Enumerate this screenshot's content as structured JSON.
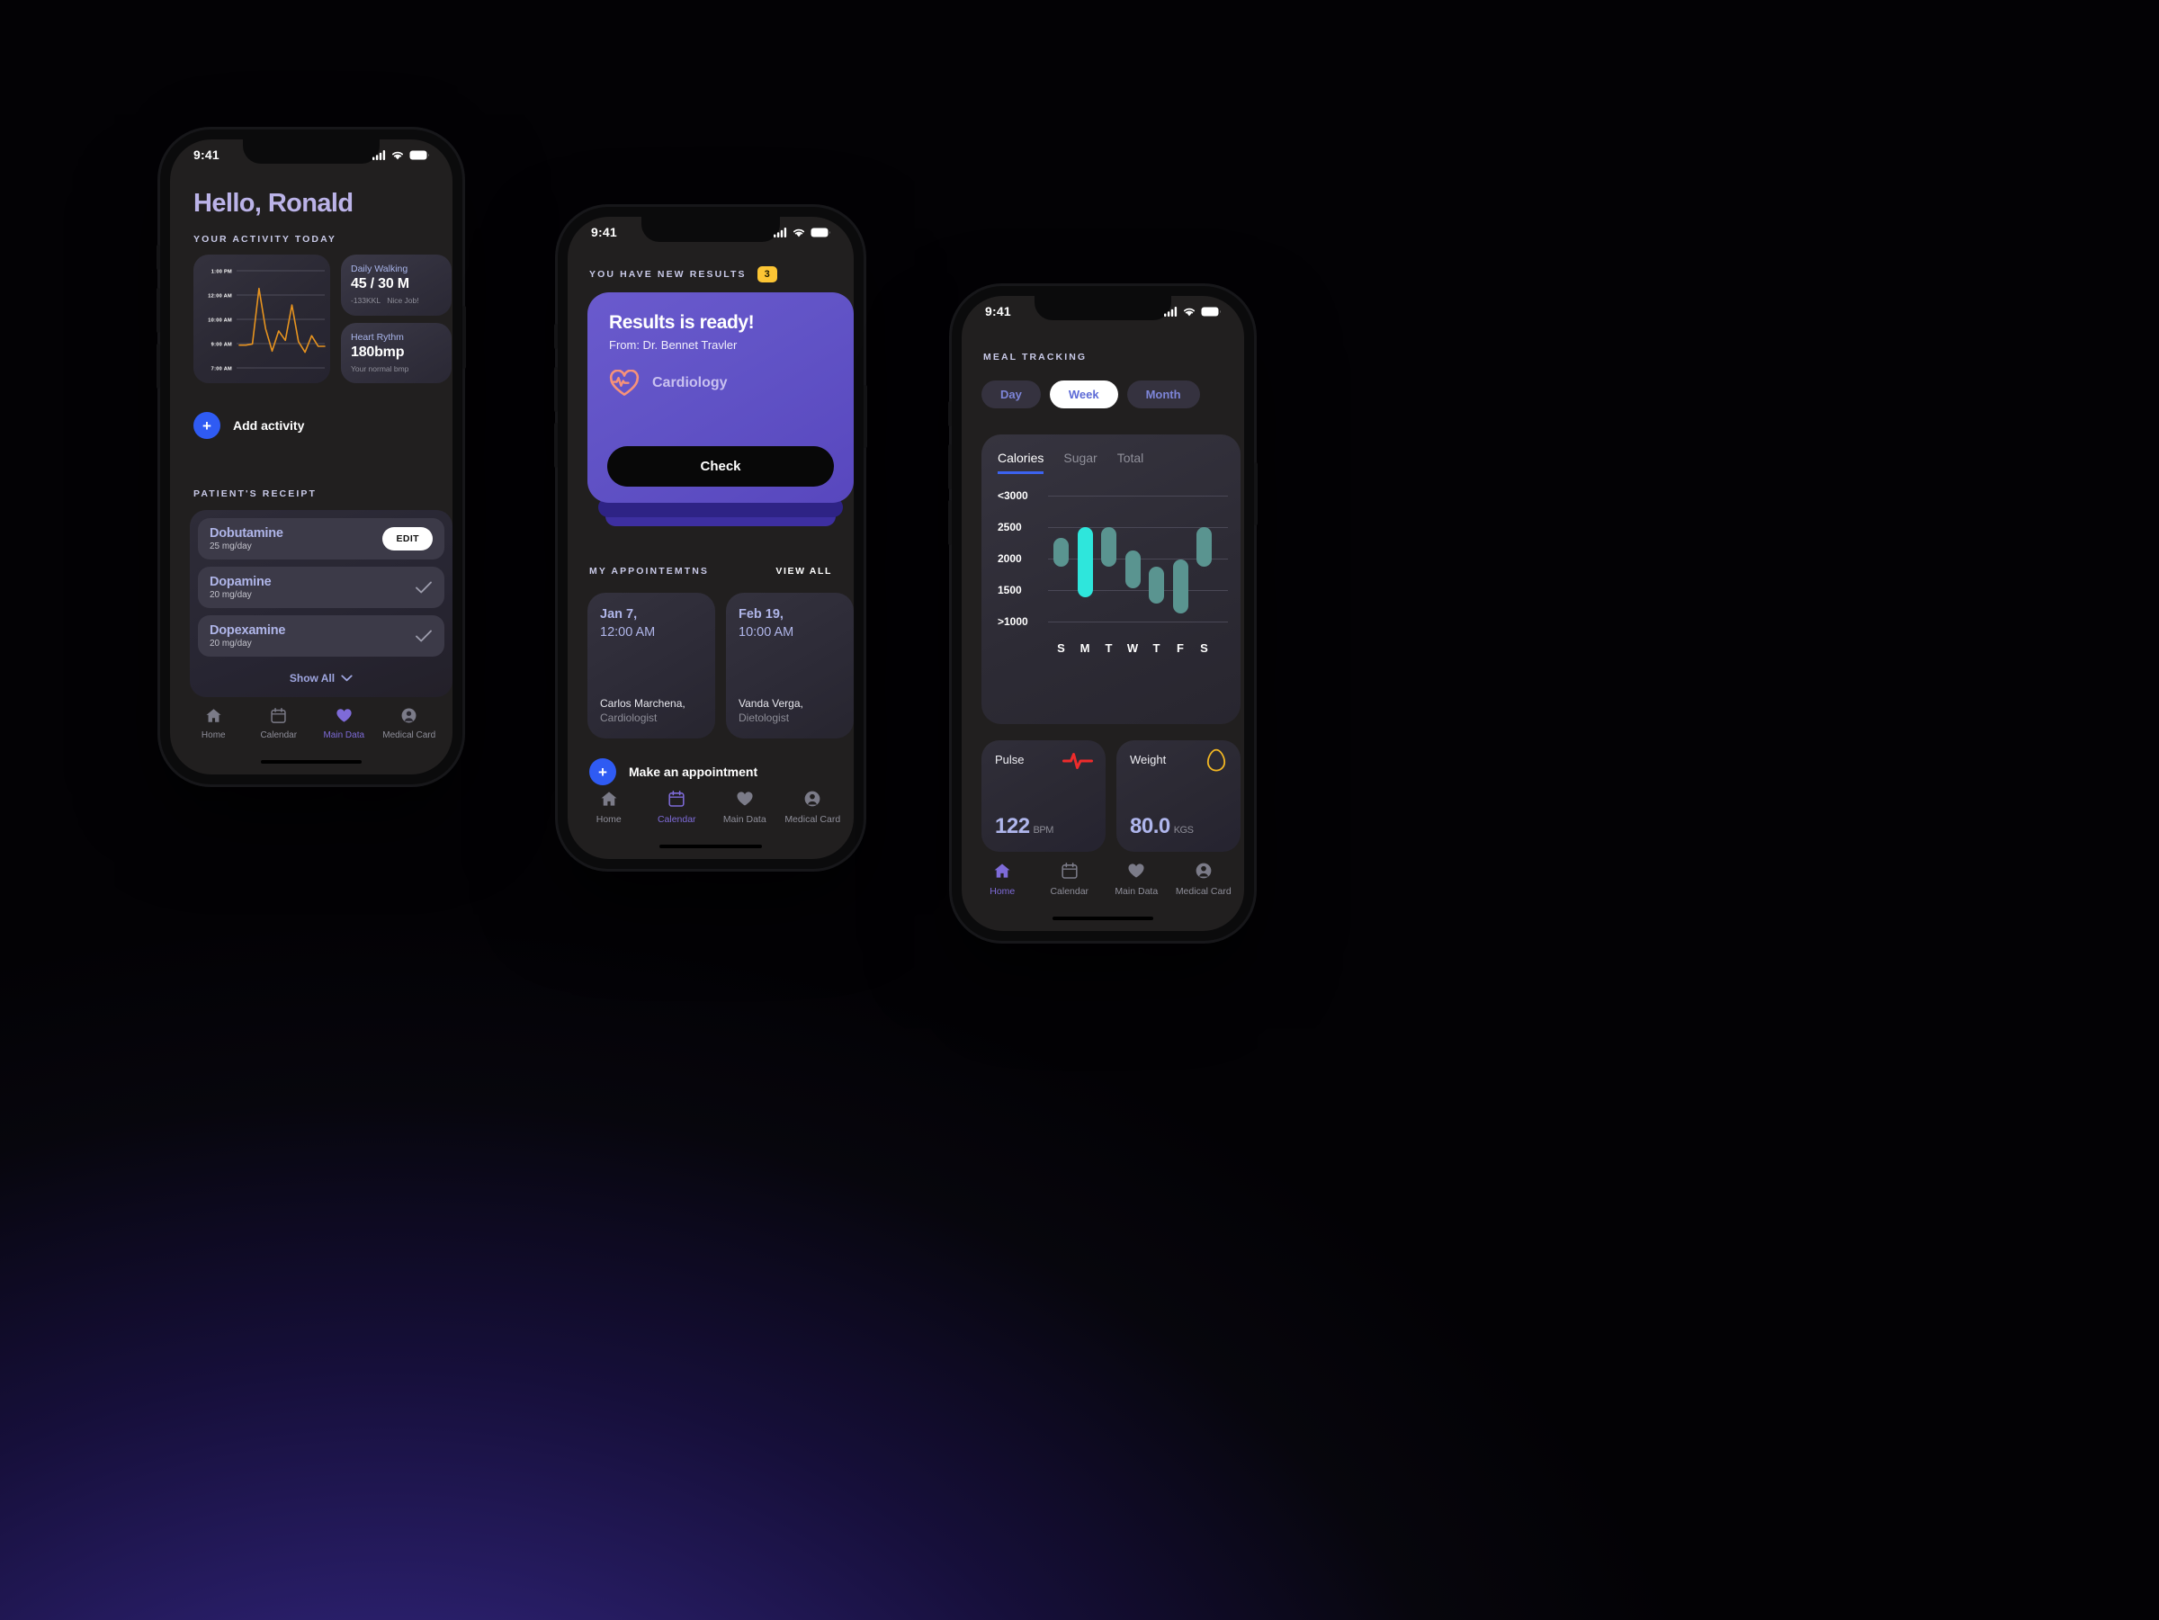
{
  "theme": {
    "accent_blue": "#2F5BF3",
    "accent_purple": "#6A5ACD",
    "accent_lavender": "#BBB3E8",
    "badge_yellow": "#FCC534",
    "bar_teal": "#5A9490",
    "bar_cyan": "#2EE6DC",
    "line_orange": "#E8941F",
    "pulse_red": "#EE2B2B",
    "egg_yellow": "#F2B723"
  },
  "phone1": {
    "status": {
      "time": "9:41",
      "signal": "signal-icon",
      "wifi": "wifi-icon",
      "battery": "battery-icon"
    },
    "greeting": "Hello, Ronald",
    "activity_label": "YOUR ACTIVITY TODAY",
    "chart": {
      "y_ticks": [
        "1:00 PM",
        "12:00 AM",
        "10:00 AM",
        "9:00 AM",
        "7:00 AM"
      ]
    },
    "stats": [
      {
        "title": "Daily Walking",
        "value": "45 / 30 M",
        "sub_left": "-133KKL",
        "sub_right": "Nice Job!"
      },
      {
        "title": "Heart Rythm",
        "value": "180bmp",
        "sub_left": "Your normal bmp",
        "sub_right": ""
      }
    ],
    "add_activity": {
      "icon": "plus-icon",
      "label": "Add activity"
    },
    "receipt_label": "PATIENT'S RECEIPT",
    "medications": [
      {
        "name": "Dobutamine",
        "dose": "25 mg/day",
        "action": "EDIT",
        "checked": false
      },
      {
        "name": "Dopamine",
        "dose": "20 mg/day",
        "action": "",
        "checked": true
      },
      {
        "name": "Dopexamine",
        "dose": "20 mg/day",
        "action": "",
        "checked": true
      }
    ],
    "show_all": "Show All",
    "nav": [
      {
        "label": "Home",
        "icon": "home-icon",
        "active": false
      },
      {
        "label": "Calendar",
        "icon": "calendar-icon",
        "active": false
      },
      {
        "label": "Main Data",
        "icon": "heart-icon",
        "active": true
      },
      {
        "label": "Medical Card",
        "icon": "person-icon",
        "active": false
      }
    ]
  },
  "phone2": {
    "status": {
      "time": "9:41",
      "signal": "signal-icon",
      "wifi": "wifi-icon",
      "battery": "battery-icon"
    },
    "results_label": "YOU HAVE NEW RESULTS",
    "results_count": "3",
    "card": {
      "title": "Results is ready!",
      "from": "From: Dr. Bennet Travler",
      "specialty": "Cardiology",
      "specialty_icon": "heart-pulse-icon",
      "button": "Check"
    },
    "appointments_label": "MY APPOINTEMTNS",
    "view_all": "VIEW ALL",
    "appointments": [
      {
        "date": "Jan 7,",
        "time": "12:00 AM",
        "name": "Carlos Marchena,",
        "role": "Cardiologist"
      },
      {
        "date": "Feb 19,",
        "time": "10:00 AM",
        "name": "Vanda Verga,",
        "role": "Dietologist"
      }
    ],
    "make_appointment": {
      "icon": "plus-icon",
      "label": "Make an appointment"
    },
    "nav": [
      {
        "label": "Home",
        "icon": "home-icon",
        "active": false
      },
      {
        "label": "Calendar",
        "icon": "calendar-icon",
        "active": true
      },
      {
        "label": "Main Data",
        "icon": "heart-icon",
        "active": false
      },
      {
        "label": "Medical Card",
        "icon": "person-icon",
        "active": false
      }
    ]
  },
  "phone3": {
    "status": {
      "time": "9:41",
      "signal": "signal-icon",
      "wifi": "wifi-icon",
      "battery": "battery-icon"
    },
    "meal_label": "MEAL TRACKING",
    "segments": [
      {
        "label": "Day",
        "active": false
      },
      {
        "label": "Week",
        "active": true
      },
      {
        "label": "Month",
        "active": false
      }
    ],
    "tabs": [
      {
        "label": "Calories",
        "active": true
      },
      {
        "label": "Sugar",
        "active": false
      },
      {
        "label": "Total",
        "active": false
      }
    ],
    "metrics": [
      {
        "title": "Pulse",
        "icon": "pulse-line-icon",
        "value": "122",
        "unit": "BPM"
      },
      {
        "title": "Weight",
        "icon": "egg-icon",
        "value": "80.0",
        "unit": "KGS"
      }
    ],
    "nav": [
      {
        "label": "Home",
        "icon": "home-icon",
        "active": true
      },
      {
        "label": "Calendar",
        "icon": "calendar-icon",
        "active": false
      },
      {
        "label": "Main Data",
        "icon": "heart-icon",
        "active": false
      },
      {
        "label": "Medical Card",
        "icon": "person-icon",
        "active": false
      }
    ]
  },
  "chart_data": [
    {
      "type": "line",
      "title": "Your activity today",
      "xlabel": "",
      "ylabel": "",
      "y_tick_labels": [
        "7:00 AM",
        "9:00 AM",
        "10:00 AM",
        "12:00 AM",
        "1:00 PM"
      ],
      "y_tick_positions": [
        0,
        1,
        2,
        3,
        4
      ],
      "grid": true,
      "series": [
        {
          "name": "Activity",
          "color": "#E8941F",
          "x": [
            0,
            1,
            2,
            3,
            4,
            5,
            6,
            7,
            8,
            9,
            10,
            11,
            12,
            13
          ],
          "values": [
            0.85,
            0.85,
            0.9,
            3.25,
            1.55,
            0.6,
            1.45,
            1.05,
            2.55,
            1.0,
            0.55,
            1.25,
            0.8,
            0.8
          ]
        }
      ]
    },
    {
      "type": "bar",
      "title": "Calories",
      "subtitle": "Meal tracking — Week",
      "xlabel": "",
      "ylabel": "Calories",
      "categories": [
        "S",
        "M",
        "T",
        "W",
        "T",
        "F",
        "S"
      ],
      "y_tick_labels": [
        ">1000",
        "1500",
        "2000",
        "2500",
        "<3000"
      ],
      "ylim": [
        1000,
        3000
      ],
      "grid": true,
      "legend": "none",
      "note": "Floating range bars: each bar spans from a low to a high calorie value.",
      "bars": [
        {
          "category": "S",
          "low": 1870,
          "high": 2330,
          "color": "#5A9490",
          "highlight": false
        },
        {
          "category": "M",
          "low": 1390,
          "high": 2500,
          "color": "#2EE6DC",
          "highlight": true
        },
        {
          "category": "T",
          "low": 1870,
          "high": 2500,
          "color": "#5A9490",
          "highlight": false
        },
        {
          "category": "W",
          "low": 1530,
          "high": 2130,
          "color": "#5A9490",
          "highlight": false
        },
        {
          "category": "T",
          "low": 1280,
          "high": 1870,
          "color": "#5A9490",
          "highlight": false
        },
        {
          "category": "F",
          "low": 1130,
          "high": 1990,
          "color": "#5A9490",
          "highlight": false
        },
        {
          "category": "S",
          "low": 1870,
          "high": 2500,
          "color": "#5A9490",
          "highlight": false
        }
      ]
    }
  ]
}
